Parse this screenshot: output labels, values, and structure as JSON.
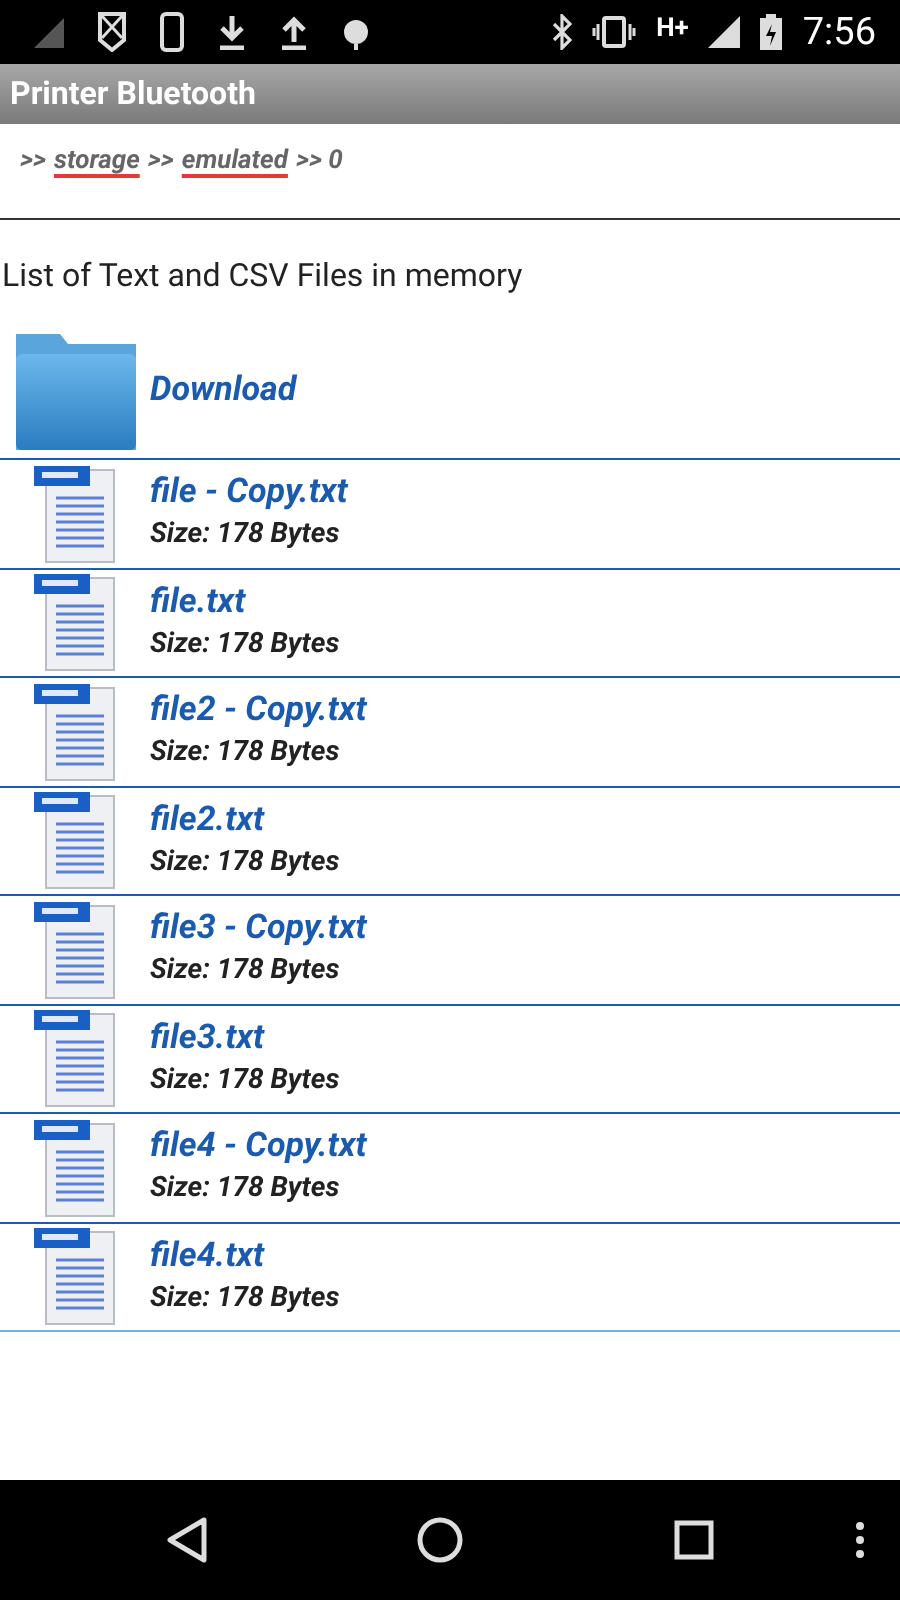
{
  "status_bar": {
    "network": "H+",
    "time": "7:56"
  },
  "title": "Printer Bluetooth",
  "breadcrumb": [
    {
      "text": ">>",
      "underlined": false
    },
    {
      "text": "storage",
      "underlined": true
    },
    {
      "text": ">>",
      "underlined": false
    },
    {
      "text": "emulated",
      "underlined": true
    },
    {
      "text": ">> 0",
      "underlined": false
    }
  ],
  "heading": "List of Text and CSV Files in memory",
  "items": [
    {
      "kind": "folder",
      "name": "Download"
    },
    {
      "kind": "file",
      "name": "file - Copy.txt",
      "size": "Size: 178 Bytes"
    },
    {
      "kind": "file",
      "name": "file.txt",
      "size": "Size: 178 Bytes"
    },
    {
      "kind": "file",
      "name": "file2 - Copy.txt",
      "size": "Size: 178 Bytes"
    },
    {
      "kind": "file",
      "name": "file2.txt",
      "size": "Size: 178 Bytes"
    },
    {
      "kind": "file",
      "name": "file3 - Copy.txt",
      "size": "Size: 178 Bytes"
    },
    {
      "kind": "file",
      "name": "file3.txt",
      "size": "Size: 178 Bytes"
    },
    {
      "kind": "file",
      "name": "file4 - Copy.txt",
      "size": "Size: 178 Bytes"
    },
    {
      "kind": "file",
      "name": "file4.txt",
      "size": "Size: 178 Bytes"
    }
  ]
}
